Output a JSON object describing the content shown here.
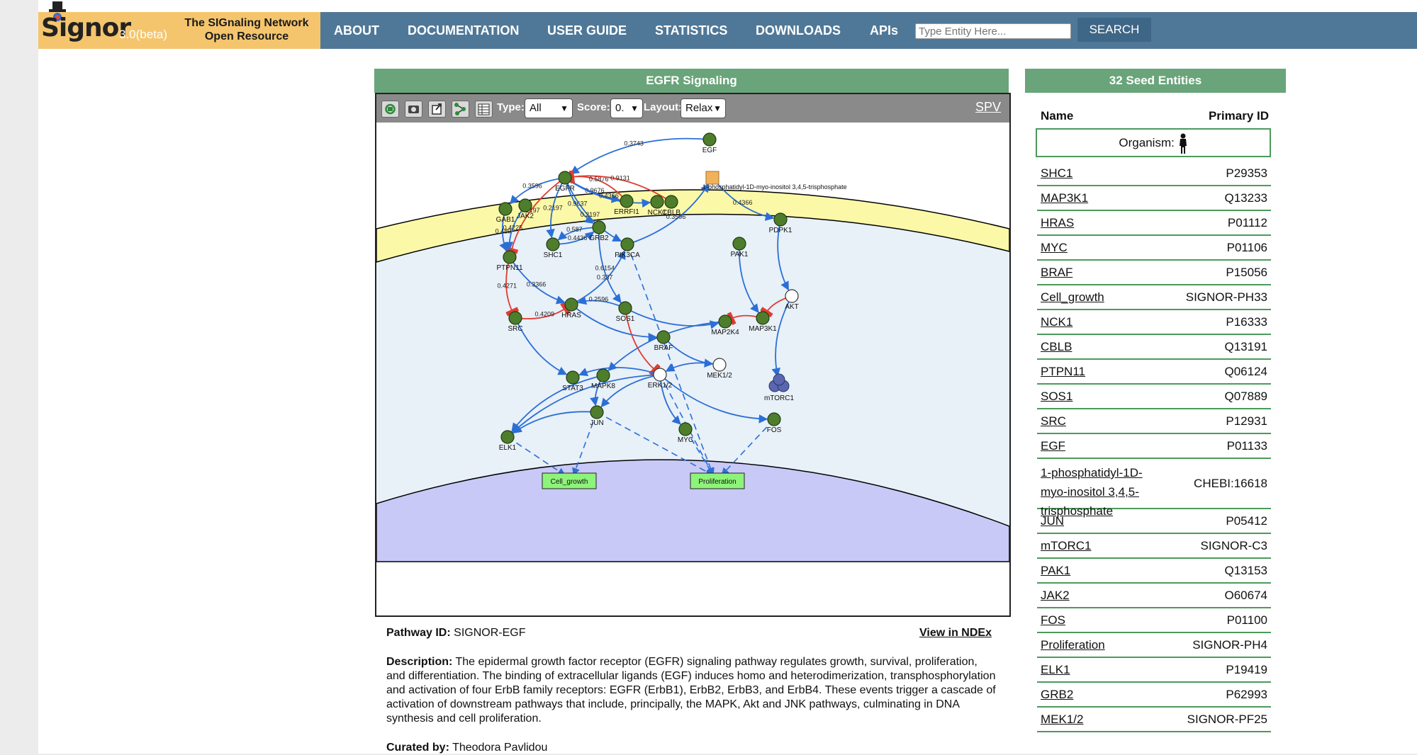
{
  "header": {
    "logo_word": "Signor",
    "logo_version": "3.0(beta)",
    "tagline_line1": "The SIGnaling Network",
    "tagline_line2": "Open Resource",
    "nav": [
      "ABOUT",
      "DOCUMENTATION",
      "USER GUIDE",
      "STATISTICS",
      "DOWNLOADS",
      "APIs"
    ],
    "search_placeholder": "Type Entity Here...",
    "search_button": "SEARCH"
  },
  "pathway_panel": {
    "title": "EGFR Signaling",
    "toolbar": {
      "type_label": "Type:",
      "type_value": "All",
      "score_label": "Score:",
      "score_value": "0.",
      "layout_label": "Layout:",
      "layout_value": "Relax",
      "spv_label": "SPV"
    },
    "graph": {
      "nodes": {
        "egf": "EGF",
        "egfr": "EGFR",
        "pip3": "1-phosphatidyl-1D-myo-inositol 3,4,5-trisphosphate",
        "grb1": "GAB1",
        "jak2": "JAK2",
        "errfi1": "ERRFI1",
        "nck1": "NCK1",
        "cblb": "CBLB",
        "pdpk1": "PDPK1",
        "grb2": "GRB2",
        "shc1": "SHC1",
        "pik3ca": "PIK3CA",
        "pak1": "PAK1",
        "ptpn11": "PTPN11",
        "akt": "AKT",
        "hras": "HRAS",
        "sos1": "SOS1",
        "src": "SRC",
        "map2k4": "MAP2K4",
        "map3k1": "MAP3K1",
        "braf": "BRAF",
        "mek": "MEK1/2",
        "stat3": "STAT3",
        "mapk8": "MAPK8",
        "erk": "ERK1/2",
        "mtorc1": "mTORC1",
        "jun": "JUN",
        "myc": "MYC",
        "fos": "FOS",
        "elk1": "ELK1",
        "cell_growth": "Cell_growth",
        "proliferation": "Proliferation"
      },
      "edge_labels": [
        "0.3743",
        "0.9676",
        "0.5876",
        "0.4366",
        "0.9131",
        "0.3596",
        "0.9637",
        "0.2197",
        "0.2197",
        "0.2197",
        "0.4225",
        "0.489",
        "0.4436",
        "0.6154",
        "0.587",
        "0.4271",
        "0.4209",
        "0.2596",
        "0.337",
        "0.3366",
        "0.3596",
        "0.4366"
      ]
    },
    "pathway_id_label": "Pathway ID:",
    "pathway_id": "SIGNOR-EGF",
    "ndex_link": "View in NDEx",
    "description_label": "Description:",
    "description": "The epidermal growth factor receptor (EGFR) signaling pathway regulates growth, survival, proliferation, and differentiation. The binding of extracellular ligands (EGF) induces homo and heterodimerization, transphosphorylation and activation of four ErbB family receptors: EGFR (ErbB1), ErbB2, ErbB3, and ErbB4. These events trigger a cascade of activation of downstream pathways that include, principally, the MAPK, Akt and JNK pathways, culminating in DNA synthesis and cell proliferation.",
    "curated_label": "Curated by:",
    "curated_by": "Theodora Pavlidou"
  },
  "entities_panel": {
    "title": "32 Seed Entities",
    "col_name": "Name",
    "col_id": "Primary ID",
    "organism_label": "Organism:",
    "rows": [
      {
        "name": "SHC1",
        "id": "P29353"
      },
      {
        "name": "MAP3K1",
        "id": "Q13233"
      },
      {
        "name": "HRAS",
        "id": "P01112"
      },
      {
        "name": "MYC",
        "id": "P01106"
      },
      {
        "name": "BRAF",
        "id": "P15056"
      },
      {
        "name": "Cell_growth",
        "id": "SIGNOR-PH33"
      },
      {
        "name": "NCK1",
        "id": "P16333"
      },
      {
        "name": "CBLB",
        "id": "Q13191"
      },
      {
        "name": "PTPN11",
        "id": "Q06124"
      },
      {
        "name": "SOS1",
        "id": "Q07889"
      },
      {
        "name": "SRC",
        "id": "P12931"
      },
      {
        "name": "EGF",
        "id": "P01133"
      },
      {
        "name": "1-phosphatidyl-1D-myo-inositol 3,4,5-trisphosphate",
        "name_lines": [
          "1-phosphatidyl-1D-",
          "myo-inositol 3,4,5-",
          "trisphosphate"
        ],
        "id": "CHEBI:16618"
      },
      {
        "name": "JUN",
        "id": "P05412"
      },
      {
        "name": "mTORC1",
        "id": "SIGNOR-C3"
      },
      {
        "name": "PAK1",
        "id": "Q13153"
      },
      {
        "name": "JAK2",
        "id": "O60674"
      },
      {
        "name": "FOS",
        "id": "P01100"
      },
      {
        "name": "Proliferation",
        "id": "SIGNOR-PH4"
      },
      {
        "name": "ELK1",
        "id": "P19419"
      },
      {
        "name": "GRB2",
        "id": "P62993"
      },
      {
        "name": "MEK1/2",
        "id": "SIGNOR-PF25"
      }
    ]
  }
}
